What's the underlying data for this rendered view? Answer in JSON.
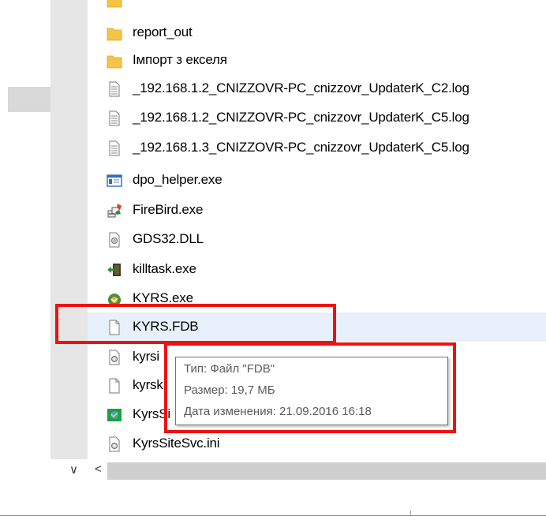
{
  "files": [
    {
      "name": "",
      "icon": "folder-icon"
    },
    {
      "name": "report_out",
      "icon": "folder-icon"
    },
    {
      "name": "Імпорт з екселя",
      "icon": "folder-icon"
    },
    {
      "name": "_192.168.1.2_CNIZZOVR-PC_cnizzovr_UpdaterK_C2.log",
      "icon": "text-file-icon"
    },
    {
      "name": "_192.168.1.2_CNIZZOVR-PC_cnizzovr_UpdaterK_C5.log",
      "icon": "text-file-icon"
    },
    {
      "name": "_192.168.1.3_CNIZZOVR-PC_cnizzovr_UpdaterK_C5.log",
      "icon": "text-file-icon"
    },
    {
      "name": "dpo_helper.exe",
      "icon": "window-exe-icon"
    },
    {
      "name": "FireBird.exe",
      "icon": "firebird-icon"
    },
    {
      "name": "GDS32.DLL",
      "icon": "dll-gear-icon"
    },
    {
      "name": "killtask.exe",
      "icon": "killtask-icon"
    },
    {
      "name": "KYRS.exe",
      "icon": "kyrs-app-icon"
    },
    {
      "name": "KYRS.FDB",
      "icon": "blank-file-icon"
    },
    {
      "name": "kyrsi",
      "icon": "config-file-icon"
    },
    {
      "name": "kyrsk",
      "icon": "blank-file-icon"
    },
    {
      "name": "KyrsSi",
      "icon": "kyrs-site-icon"
    },
    {
      "name": "KyrsSiteSvc.ini",
      "icon": "config-file-icon"
    }
  ],
  "tooltip": {
    "type": "Тип: Файл \"FDB\"",
    "size": "Размер: 19,7 МБ",
    "modified": "Дата изменения: 21.09.2016 16:18"
  },
  "scrollbar": {
    "chevron": "∨",
    "left_arrow": "<"
  },
  "colors": {
    "highlight": "#e8f1fb",
    "annotation": "#f01010",
    "folder": "#f6c443"
  }
}
